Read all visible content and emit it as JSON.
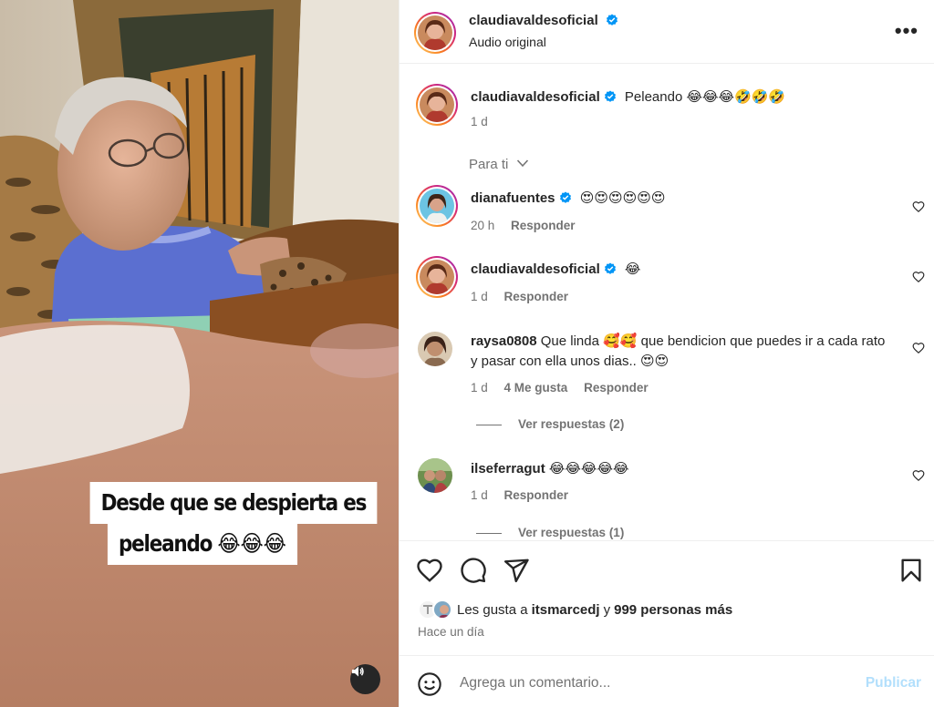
{
  "media": {
    "caption_line1": "Desde que se despierta es",
    "caption_line2": "peleando",
    "caption_emoji": "😂😂😂",
    "audio_icon": "speaker-icon"
  },
  "header": {
    "username": "claudiavaldesoficial",
    "subtitle": "Audio original",
    "more_icon": "•••"
  },
  "post": {
    "username": "claudiavaldesoficial",
    "text": "Peleando 😂😂😂🤣🤣🤣",
    "time": "1 d"
  },
  "filter": {
    "label": "Para ti",
    "chevron": "⌄"
  },
  "comments": [
    {
      "username": "dianafuentes",
      "verified": true,
      "text": "😍😍😍😍😍😍",
      "time": "20 h",
      "reply": "Responder"
    },
    {
      "username": "claudiavaldesoficial",
      "verified": true,
      "text": "😂",
      "time": "1 d",
      "reply": "Responder"
    },
    {
      "username": "raysa0808",
      "verified": false,
      "text": "Que linda 🥰🥰 que bendicion que puedes ir a cada rato y pasar con ella unos dias.. 😍😍",
      "time": "1 d",
      "likes": "4 Me gusta",
      "reply": "Responder",
      "view_replies": "Ver respuestas (2)"
    },
    {
      "username": "ilseferragut",
      "verified": false,
      "text": "😂😂😂😂😂",
      "time": "1 d",
      "reply": "Responder",
      "view_replies": "Ver respuestas (1)"
    }
  ],
  "likes": {
    "prefix": "Les gusta a",
    "user": "itsmarcedj",
    "joiner": "y",
    "others": "999 personas más",
    "time_ago": "Hace un día"
  },
  "add_comment": {
    "placeholder": "Agrega un comentario...",
    "publish_label": "Publicar"
  },
  "colors": {
    "verified": "#0095f6",
    "publish_disabled": "#b2dffc",
    "secondary_text": "#737373"
  }
}
